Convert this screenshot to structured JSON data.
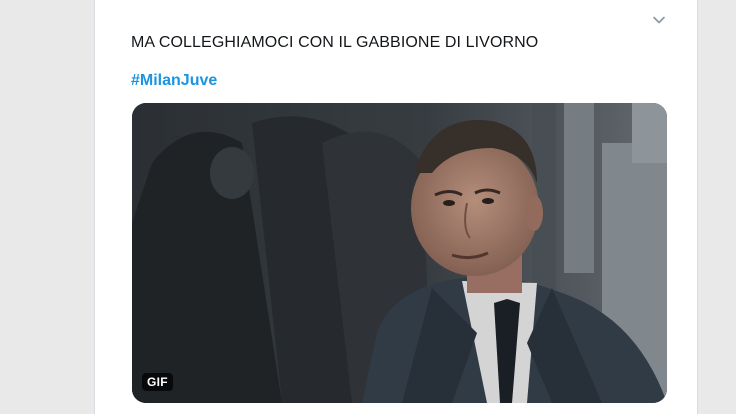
{
  "tweet": {
    "text": "MA COLLEGHIAMOCI CON IL GABBIONE DI LIVORNO",
    "hashtag": "#MilanJuve",
    "media": {
      "badge": "GIF"
    },
    "menu_icon": "chevron-down-icon"
  },
  "colors": {
    "hashtag": "#1b95e0",
    "text": "#14171a",
    "background": "#e9e9e9"
  }
}
